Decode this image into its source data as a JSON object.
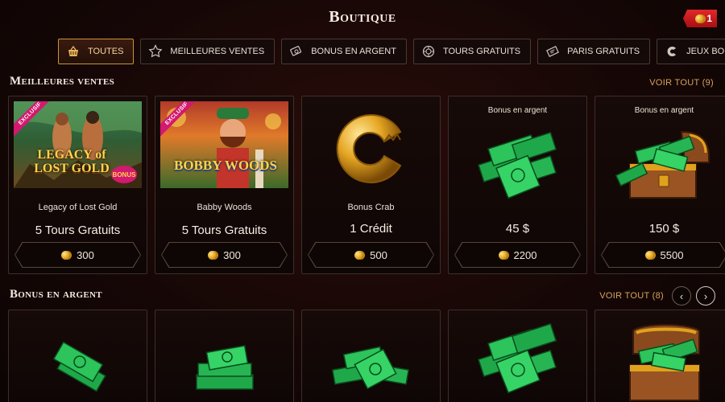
{
  "header": {
    "title": "Boutique",
    "balance": "1"
  },
  "tabs": [
    {
      "label": "TOUTES",
      "icon": "basket-icon",
      "active": true
    },
    {
      "label": "MEILLEURES VENTES",
      "icon": "star-icon",
      "active": false
    },
    {
      "label": "BONUS EN ARGENT",
      "icon": "cash-icon",
      "active": false
    },
    {
      "label": "TOURS GRATUITS",
      "icon": "spin-icon",
      "active": false
    },
    {
      "label": "PARIS GRATUITS",
      "icon": "ticket-icon",
      "active": false
    },
    {
      "label": "JEUX BONUS",
      "icon": "crab-icon",
      "active": false
    }
  ],
  "best_sellers": {
    "title": "Meilleures ventes",
    "see_all": "VOIR TOUT (9)",
    "cards": [
      {
        "badge": "EXCLUSIF",
        "game_logo": "LEGACY of LOST GOLD",
        "game_logo_bonus": "BONUS",
        "name": "Legacy of Lost Gold",
        "reward": "5 Tours Gratuits",
        "price": "300"
      },
      {
        "badge": "EXCLUSIF",
        "game_logo": "BOBBY WOODS",
        "name": "Babby Woods",
        "reward": "5 Tours Gratuits",
        "price": "300"
      },
      {
        "name": "Bonus Crab",
        "reward": "1 Crédit",
        "price": "500"
      },
      {
        "category": "Bonus en argent",
        "reward": "45 $",
        "price": "2200"
      },
      {
        "category": "Bonus en argent",
        "reward": "150 $",
        "price": "5500"
      }
    ]
  },
  "cash_bonus": {
    "title": "Bonus en argent",
    "see_all": "VOIR TOUT (8)",
    "prev": "‹",
    "next": "›"
  },
  "colors": {
    "accent": "#d9a25a",
    "cash_green": "#1fa84a",
    "gold": "#e0a21c",
    "badge_pink": "#d3186f"
  }
}
